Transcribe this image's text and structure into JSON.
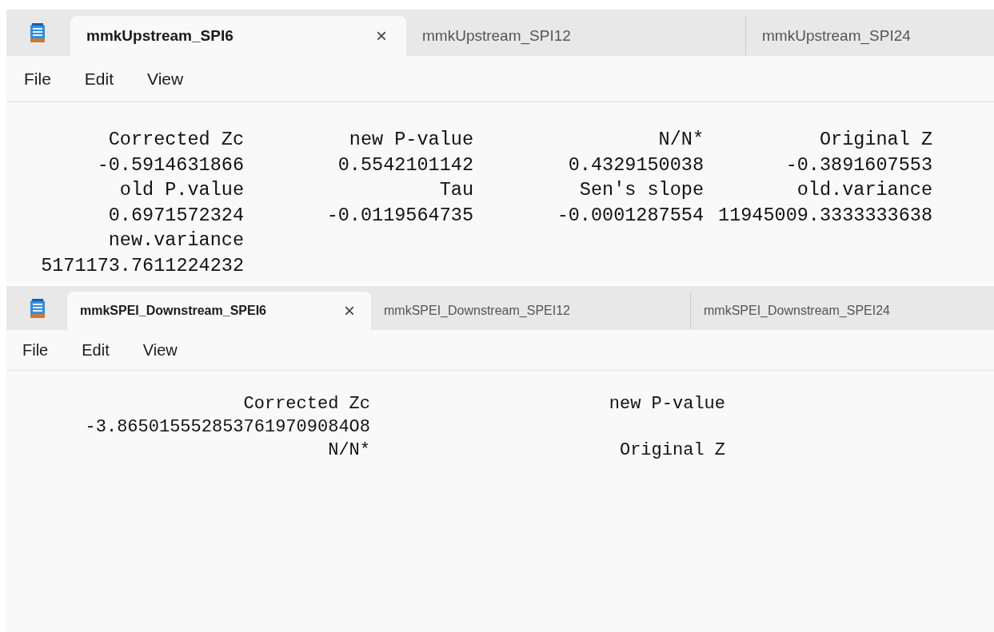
{
  "windows": [
    {
      "tabs": [
        {
          "label": "mmkUpstream_SPI6",
          "selected": true,
          "close": "×"
        },
        {
          "label": "mmkUpstream_SPI12",
          "selected": false
        },
        {
          "label": "mmkUpstream_SPI24",
          "selected": false
        }
      ],
      "menu": [
        "File",
        "Edit",
        "View"
      ],
      "rows": [
        [
          "Corrected Zc",
          "new P-value",
          "N/N*",
          "Original Z"
        ],
        [
          "-0.5914631866",
          "0.5542101142",
          "0.4329150038",
          "-0.3891607553"
        ],
        [
          "old P.value",
          "Tau",
          "Sen's slope",
          "old.variance"
        ],
        [
          "0.6971572324",
          "-0.0119564735",
          "-0.0001287554",
          "11945009.3333333638"
        ],
        [
          "new.variance"
        ],
        [
          "5171173.7611224232"
        ]
      ]
    },
    {
      "tabs": [
        {
          "label": "mmkSPEI_Downstream_SPEI6",
          "selected": true,
          "close": "×"
        },
        {
          "label": "mmkSPEI_Downstream_SPEI12",
          "selected": false
        },
        {
          "label": "mmkSPEI_Downstream_SPEI24",
          "selected": false
        }
      ],
      "menu": [
        "File",
        "Edit",
        "View"
      ],
      "rows": [
        [
          "Corrected Zc",
          "new P-value"
        ],
        [
          "-3.8650155528537619709084O8"
        ],
        [
          "N/N*",
          "Original Z"
        ]
      ]
    }
  ]
}
